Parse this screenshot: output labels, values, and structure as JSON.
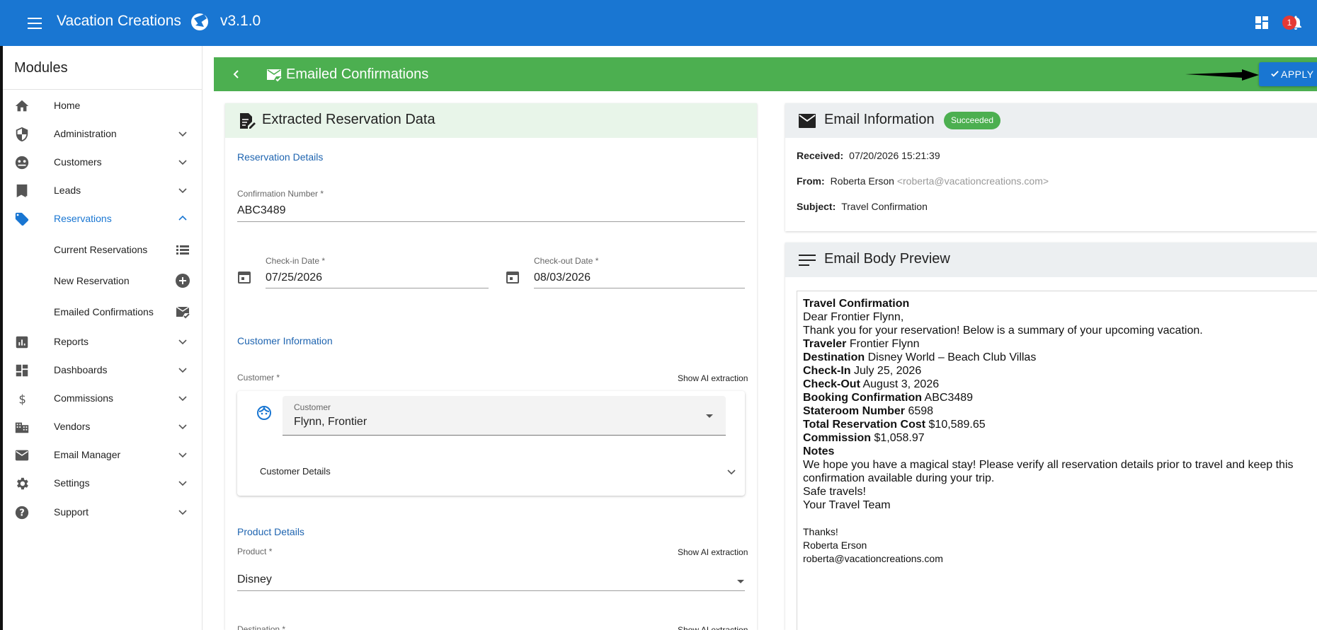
{
  "app": {
    "title": "Vacation Creations",
    "version": "v3.1.0",
    "notification_count": "1",
    "brand_color": "#1976d2"
  },
  "sidebar": {
    "heading": "Modules",
    "items": [
      {
        "label": "Home",
        "icon": "home-icon"
      },
      {
        "label": "Administration",
        "icon": "shield-icon"
      },
      {
        "label": "Customers",
        "icon": "customers-icon"
      },
      {
        "label": "Leads",
        "icon": "book-icon"
      },
      {
        "label": "Reservations",
        "icon": "tag-icon",
        "expanded": true
      },
      {
        "label": "Reports",
        "icon": "chart-icon"
      },
      {
        "label": "Dashboards",
        "icon": "dashboard-icon"
      },
      {
        "label": "Commissions",
        "icon": "dollar-icon"
      },
      {
        "label": "Vendors",
        "icon": "building-icon"
      },
      {
        "label": "Email Manager",
        "icon": "mail-icon"
      },
      {
        "label": "Settings",
        "icon": "gear-icon"
      },
      {
        "label": "Support",
        "icon": "help-icon"
      }
    ],
    "sub_items": [
      {
        "label": "Current Reservations",
        "icon": "list-icon"
      },
      {
        "label": "New Reservation",
        "icon": "plus-circle-icon"
      },
      {
        "label": "Emailed Confirmations",
        "icon": "mail-check-icon"
      }
    ]
  },
  "page": {
    "title": "Emailed Confirmations",
    "apply_label": "APPLY",
    "header_color": "#4caf50"
  },
  "extracted": {
    "title": "Extracted Reservation Data",
    "reservation_details": "Reservation Details",
    "confirmation_label": "Confirmation Number *",
    "confirmation_value": "ABC3489",
    "checkin_label": "Check-in Date *",
    "checkin_value": "07/25/2026",
    "checkout_label": "Check-out Date *",
    "checkout_value": "08/03/2026",
    "customer_information": "Customer Information",
    "customer_label": "Customer *",
    "show_ai": "Show AI extraction",
    "customer_select_label": "Customer",
    "customer_select_value": "Flynn, Frontier",
    "customer_details": "Customer Details",
    "product_details": "Product Details",
    "product_label": "Product *",
    "product_value": "Disney",
    "destination_label": "Destination *"
  },
  "email_info": {
    "title": "Email Information",
    "status": "Succeeded",
    "received_label": "Received:",
    "received_value": "07/20/2026 15:21:39",
    "from_label": "From:",
    "from_name": "Roberta Erson",
    "from_email": "<roberta@vacationcreations.com>",
    "subject_label": "Subject:",
    "subject_value": "Travel Confirmation"
  },
  "email_body": {
    "title": "Email Body Preview",
    "heading": "Travel Confirmation",
    "greeting": "Dear Frontier Flynn,",
    "intro": "Thank you for your reservation! Below is a summary of your upcoming vacation.",
    "rows": [
      {
        "k": "Traveler",
        "v": "Frontier Flynn"
      },
      {
        "k": "Destination",
        "v": "Disney World – Beach Club Villas"
      },
      {
        "k": "Check-In",
        "v": "July 25, 2026"
      },
      {
        "k": "Check-Out",
        "v": "August 3, 2026"
      },
      {
        "k": "Booking Confirmation",
        "v": "ABC3489"
      },
      {
        "k": "Stateroom Number",
        "v": "6598"
      },
      {
        "k": "Total Reservation Cost",
        "v": "$10,589.65"
      },
      {
        "k": "Commission",
        "v": "$1,058.97"
      }
    ],
    "notes_heading": "Notes",
    "notes": "We hope you have a magical stay! Please verify all reservation details prior to travel and keep this confirmation available during your trip.",
    "safe": "Safe travels!",
    "team": "Your Travel Team",
    "thanks": "Thanks!",
    "sig_name": "Roberta Erson",
    "sig_email": "roberta@vacationcreations.com"
  }
}
